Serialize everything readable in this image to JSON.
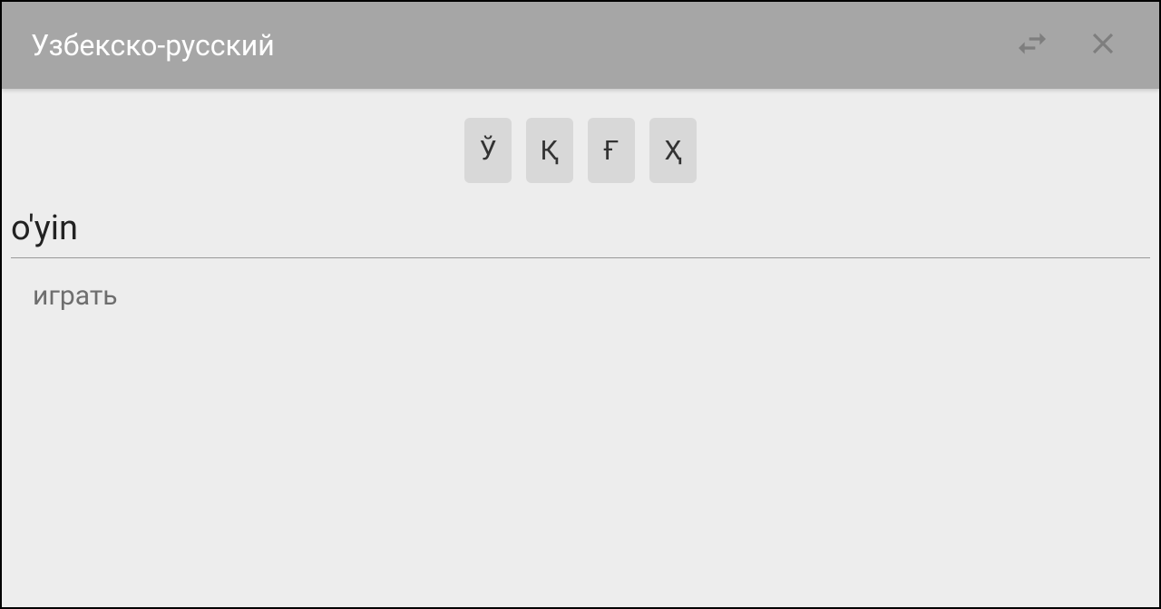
{
  "header": {
    "title": "Узбекско-русский"
  },
  "special_chars": [
    "Ў",
    "Қ",
    "Ғ",
    "Ҳ"
  ],
  "search": {
    "value": "o'yin"
  },
  "results": [
    "играть"
  ]
}
